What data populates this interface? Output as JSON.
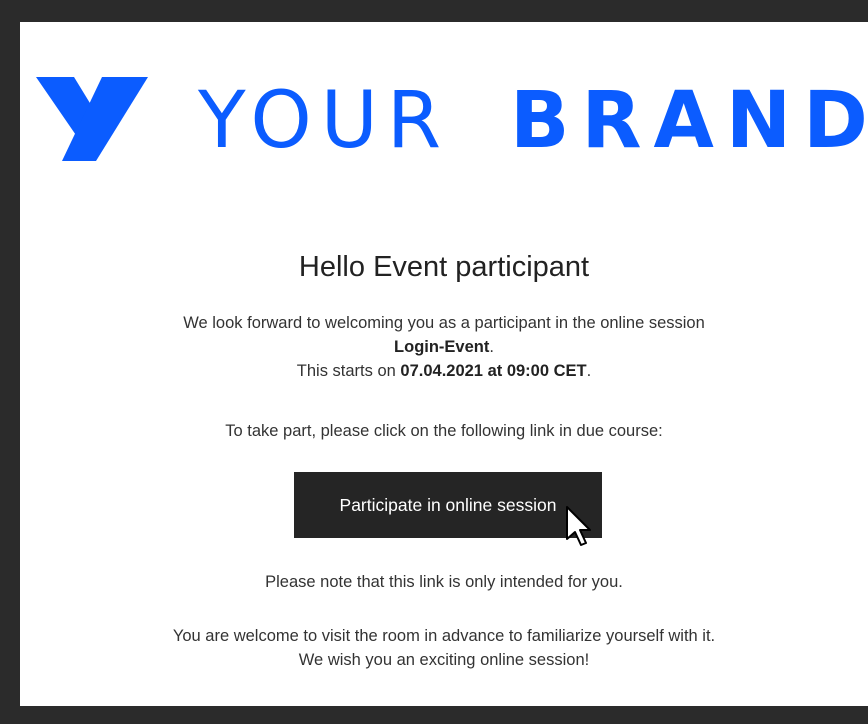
{
  "brand": {
    "word_light": "YOUR",
    "word_bold": "BRAND",
    "color": "#0b5cff",
    "logo_icon": "y-logo-mark-icon"
  },
  "greeting": "Hello Event participant",
  "intro": {
    "line1": "We look forward to welcoming you as a participant in the online session",
    "session_name": "Login-Event",
    "session_suffix": ".",
    "starts_prefix": "This starts on ",
    "start_datetime": "07.04.2021 at 09:00 CET",
    "starts_suffix": "."
  },
  "instruction": "To take part, please click on the following link in due course:",
  "cta": {
    "label": "Participate in online session",
    "bg_color": "#252525",
    "text_color": "#ffffff"
  },
  "note": "Please note that this link is only intended for you.",
  "closing": {
    "line1": "You are welcome to visit the room in advance to familiarize yourself with it.",
    "line2": "We wish you an exciting online session!"
  },
  "cursor_icon": "mouse-pointer-icon"
}
